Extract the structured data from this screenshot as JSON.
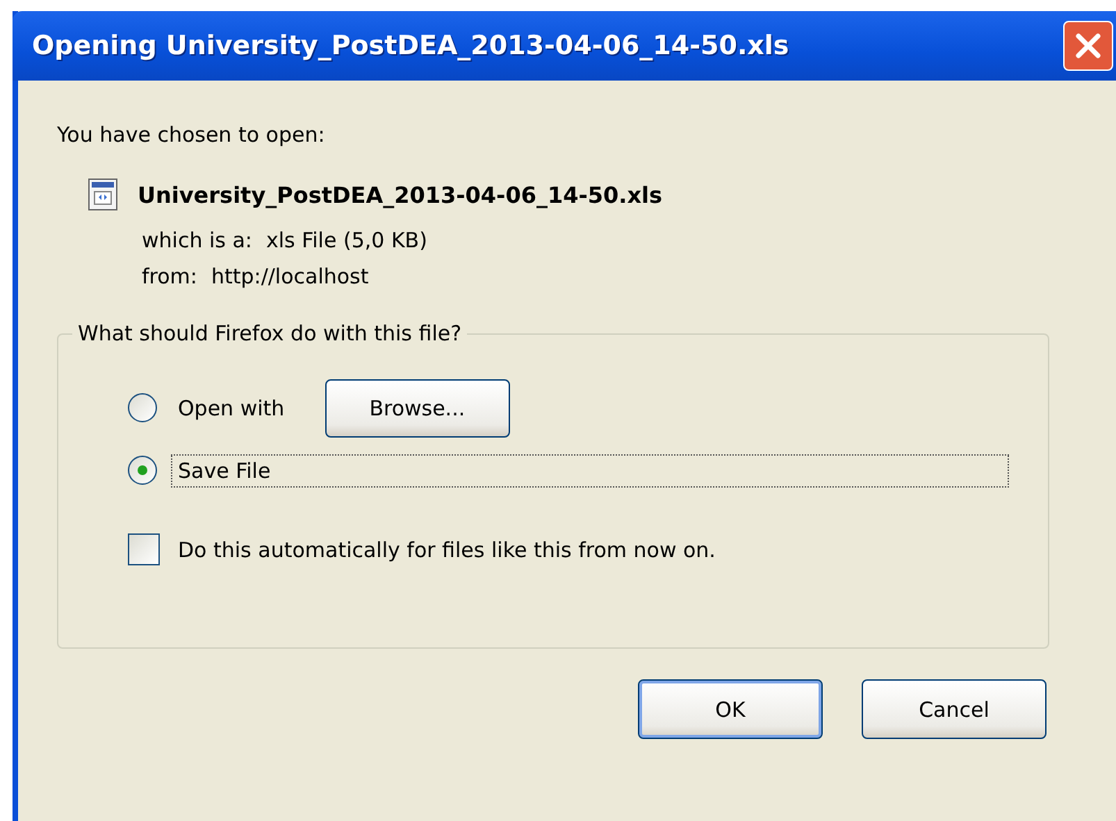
{
  "window": {
    "title": "Opening University_PostDEA_2013-04-06_14-50.xls"
  },
  "intro": "You have chosen to open:",
  "file": {
    "name": "University_PostDEA_2013-04-06_14-50.xls",
    "type_label": "which is a:",
    "type_value": "xls File (5,0 KB)",
    "from_label": "from:",
    "from_value": "http://localhost"
  },
  "group": {
    "legend": "What should Firefox do with this file?",
    "options": [
      {
        "kind": "radio",
        "label": "Open with",
        "selected": false,
        "focused": false,
        "button": "Browse..."
      },
      {
        "kind": "radio",
        "label": "Save File",
        "selected": true,
        "focused": true
      }
    ],
    "auto": {
      "label": "Do this automatically for files like this from now on.",
      "checked": false
    }
  },
  "buttons": [
    {
      "label": "OK",
      "default": true
    },
    {
      "label": "Cancel",
      "default": false
    }
  ]
}
